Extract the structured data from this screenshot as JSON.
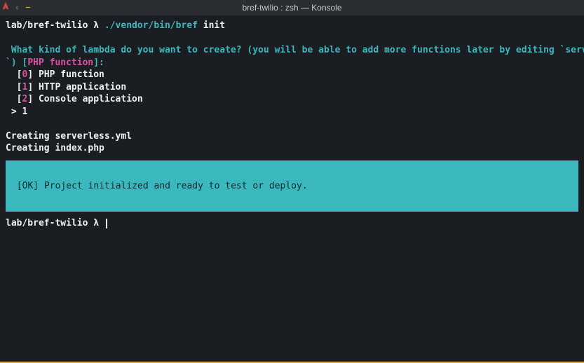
{
  "window": {
    "title": "bref-twilio : zsh — Konsole"
  },
  "prompt1": {
    "path": "lab/bref-twilio",
    "symbol": " λ ",
    "cmd_part1": "./vendor/bin/bref",
    "cmd_part2": " init"
  },
  "question": {
    "prefix": " What kind of lambda do you want to create? (you will be able to add more functions later by editing `serverless.yml",
    "line2_prefix": "`) [",
    "default": "PHP function",
    "line2_suffix": "]:"
  },
  "options": {
    "o0_prefix": "  [",
    "o0_num": "0",
    "o0_suffix": "] PHP function",
    "o1_prefix": "  [",
    "o1_num": "1",
    "o1_suffix": "] HTTP application",
    "o2_prefix": "  [",
    "o2_num": "2",
    "o2_suffix": "] Console application"
  },
  "answer": " > 1",
  "creating1": "Creating serverless.yml",
  "creating2": "Creating index.php",
  "ok": " [OK] Project initialized and ready to test or deploy.",
  "prompt2": {
    "path": "lab/bref-twilio",
    "symbol": " λ "
  }
}
